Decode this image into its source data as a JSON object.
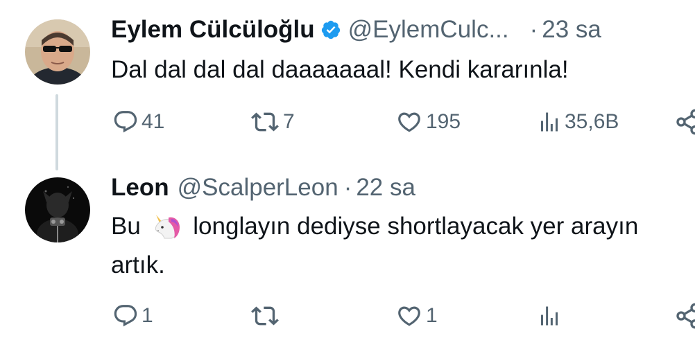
{
  "tweets": [
    {
      "author_name": "Eylem Cülcüloğlu",
      "handle": "@EylemCulc...",
      "separator": "·",
      "time": "23 sa",
      "text": "Dal dal dal dal daaaaaaal! Kendi kararınla!",
      "replies": "41",
      "retweets": "7",
      "likes": "195",
      "views": "35,6B",
      "verified_icon": "verified-badge-icon"
    },
    {
      "author_name": "Leon",
      "handle": "@ScalperLeon",
      "separator": "·",
      "time": "22 sa",
      "text_before": "Bu",
      "emoji": "unicorn-emoji",
      "text_after": "longlayın dediyse shortlayacak yer arayın",
      "text_line2": "artık.",
      "replies": "1",
      "retweets": "",
      "likes": "1",
      "views": ""
    }
  ],
  "colors": {
    "text": "#0f1419",
    "secondary": "#536471",
    "verified": "#1d9bf0",
    "thread_line": "#cfd9de"
  }
}
